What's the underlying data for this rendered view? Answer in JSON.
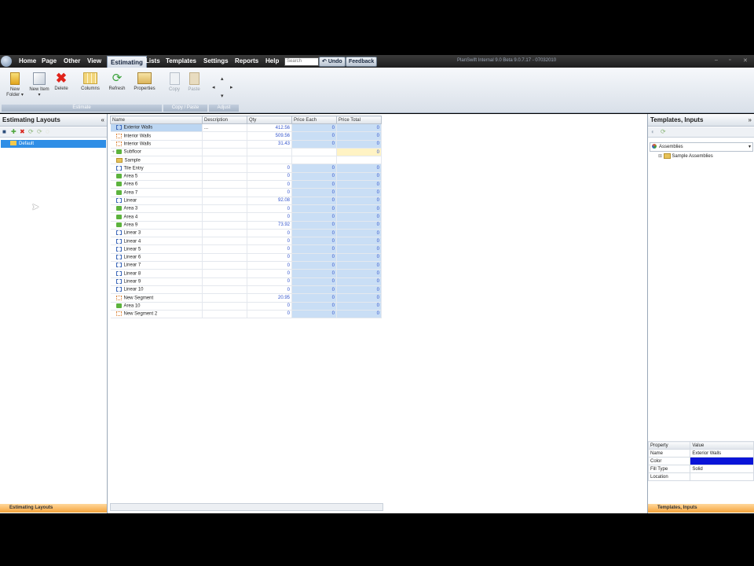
{
  "menu": {
    "items": [
      "Home",
      "Page",
      "Other",
      "View",
      "Estimating",
      "Lists",
      "Templates",
      "Settings",
      "Reports",
      "Help"
    ],
    "active": "Estimating",
    "search_placeholder": "Search",
    "undo_label": "Undo",
    "feedback_label": "Feedback"
  },
  "title_text": "PlanSwift Internal 9.0 Beta 9.0.7.17 - 07032010",
  "ribbon": {
    "new_folder": "New Folder ▾",
    "new_item": "New Item ▾",
    "delete": "Delete",
    "columns": "Columns",
    "refresh": "Refresh",
    "properties": "Properties",
    "copy": "Copy",
    "paste": "Paste",
    "group_estimate": "Estimate",
    "group_copypaste": "Copy / Paste",
    "group_adjust": "Adjust"
  },
  "left_panel": {
    "title": "Estimating Layouts",
    "selected_item": "Default",
    "bottom_tab": "Estimating Layouts"
  },
  "grid": {
    "columns": [
      "Name",
      "Description",
      "Qty",
      "Price Each",
      "Price Total"
    ],
    "rows": [
      {
        "name": "Exterior Walls",
        "icon": "linear",
        "desc": "...",
        "qty": "412.56",
        "each": "0",
        "total": "0",
        "selected": true
      },
      {
        "name": "Interior Walls",
        "icon": "seg",
        "desc": "",
        "qty": "509.56",
        "each": "0",
        "total": "0"
      },
      {
        "name": "Interior Walls",
        "icon": "seg",
        "desc": "",
        "qty": "31.43",
        "each": "0",
        "total": "0"
      },
      {
        "name": "Subfloor",
        "icon": "area",
        "desc": "",
        "qty": "",
        "each": "",
        "total": "0",
        "yellow": true,
        "expand": true
      },
      {
        "name": "Sample",
        "icon": "folder",
        "desc": "",
        "qty": "",
        "each": "",
        "total": ""
      },
      {
        "name": "Tile Entry",
        "icon": "linear",
        "desc": "",
        "qty": "0",
        "each": "0",
        "total": "0"
      },
      {
        "name": "Area 5",
        "icon": "area",
        "desc": "",
        "qty": "0",
        "each": "0",
        "total": "0"
      },
      {
        "name": "Area 6",
        "icon": "area",
        "desc": "",
        "qty": "0",
        "each": "0",
        "total": "0"
      },
      {
        "name": "Area 7",
        "icon": "area",
        "desc": "",
        "qty": "0",
        "each": "0",
        "total": "0"
      },
      {
        "name": "Linear",
        "icon": "linear",
        "desc": "",
        "qty": "92.08",
        "each": "0",
        "total": "0"
      },
      {
        "name": "Area 3",
        "icon": "area",
        "desc": "",
        "qty": "0",
        "each": "0",
        "total": "0"
      },
      {
        "name": "Area 4",
        "icon": "area",
        "desc": "",
        "qty": "0",
        "each": "0",
        "total": "0"
      },
      {
        "name": "Area 9",
        "icon": "area",
        "desc": "",
        "qty": "73.92",
        "each": "0",
        "total": "0"
      },
      {
        "name": "Linear 3",
        "icon": "linear",
        "desc": "",
        "qty": "0",
        "each": "0",
        "total": "0"
      },
      {
        "name": "Linear 4",
        "icon": "linear",
        "desc": "",
        "qty": "0",
        "each": "0",
        "total": "0"
      },
      {
        "name": "Linear 5",
        "icon": "linear",
        "desc": "",
        "qty": "0",
        "each": "0",
        "total": "0"
      },
      {
        "name": "Linear 6",
        "icon": "linear",
        "desc": "",
        "qty": "0",
        "each": "0",
        "total": "0"
      },
      {
        "name": "Linear 7",
        "icon": "linear",
        "desc": "",
        "qty": "0",
        "each": "0",
        "total": "0"
      },
      {
        "name": "Linear 8",
        "icon": "linear",
        "desc": "",
        "qty": "0",
        "each": "0",
        "total": "0"
      },
      {
        "name": "Linear 9",
        "icon": "linear",
        "desc": "",
        "qty": "0",
        "each": "0",
        "total": "0"
      },
      {
        "name": "Linear 10",
        "icon": "linear",
        "desc": "",
        "qty": "0",
        "each": "0",
        "total": "0"
      },
      {
        "name": "New Segment",
        "icon": "seg",
        "desc": "",
        "qty": "20.95",
        "each": "0",
        "total": "0"
      },
      {
        "name": "Area 10",
        "icon": "area",
        "desc": "",
        "qty": "0",
        "each": "0",
        "total": "0"
      },
      {
        "name": "New Segment 2",
        "icon": "seg",
        "desc": "",
        "qty": "0",
        "each": "0",
        "total": "0"
      }
    ]
  },
  "right_panel": {
    "title": "Templates, Inputs",
    "dropdown_value": "Assemblies",
    "tree_item": "Sample Assemblies",
    "bottom_tab": "Templates, Inputs",
    "properties": {
      "headers": [
        "Property",
        "Value"
      ],
      "rows": [
        {
          "property": "Name",
          "value": "Exterior Walls"
        },
        {
          "property": "Color",
          "value": "",
          "color": "#0a14d8"
        },
        {
          "property": "Fill Type",
          "value": "Solid"
        },
        {
          "property": "Location",
          "value": ""
        }
      ]
    }
  }
}
